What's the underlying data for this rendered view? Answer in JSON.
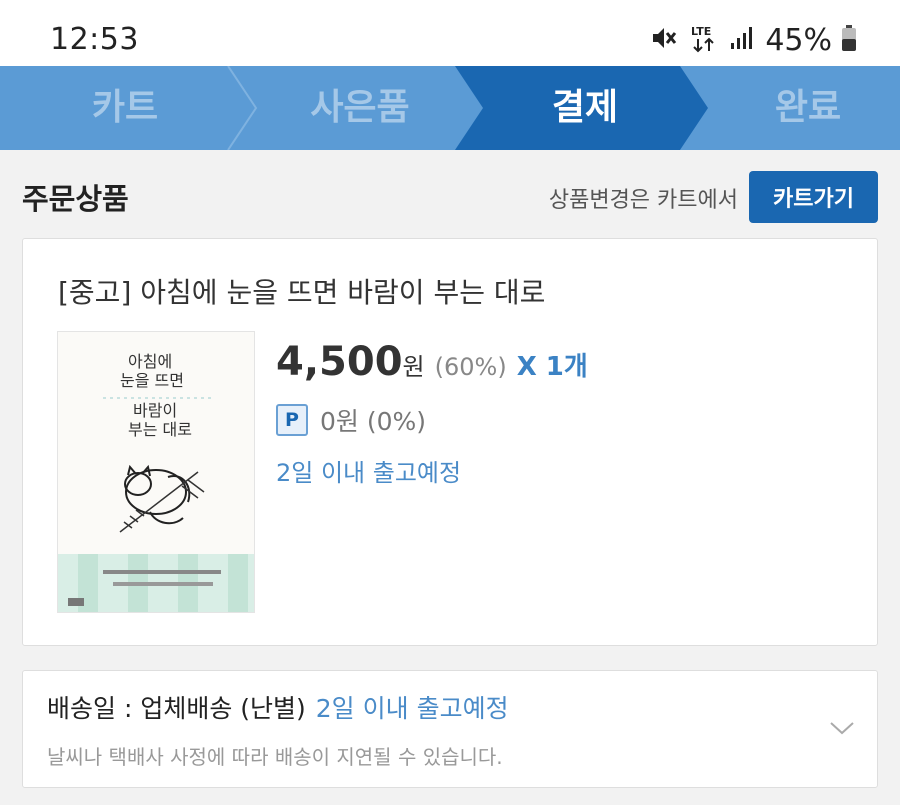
{
  "status": {
    "time": "12:53",
    "battery": "45%",
    "network": "LTE"
  },
  "steps": [
    {
      "label": "카트",
      "active": false
    },
    {
      "label": "사은품",
      "active": false
    },
    {
      "label": "결제",
      "active": true
    },
    {
      "label": "완료",
      "active": false
    }
  ],
  "section": {
    "title": "주문상품",
    "note": "상품변경은 카트에서",
    "cart_button": "카트가기"
  },
  "product": {
    "title": "[중고] 아침에 눈을 뜨면 바람이 부는 대로",
    "price": "4,500",
    "price_unit": "원",
    "discount": "(60%)",
    "quantity": "X 1개",
    "points_badge": "P",
    "points": "0원 (0%)",
    "shipping": "2일 이내 출고예정",
    "cover": {
      "title_lines": [
        "아침에",
        "눈을 뜨면",
        "바람이",
        "부는 대로"
      ]
    }
  },
  "delivery": {
    "label": "배송일 : 업체배송 (난별)",
    "eta": "2일 이내 출고예정",
    "note": "날씨나 택배사 사정에 따라 배송이 지연될 수 있습니다."
  },
  "colors": {
    "step_inactive": "#5b9bd5",
    "step_active": "#1a67b1",
    "accent_text": "#4a8bc8",
    "button": "#1a67b1"
  }
}
